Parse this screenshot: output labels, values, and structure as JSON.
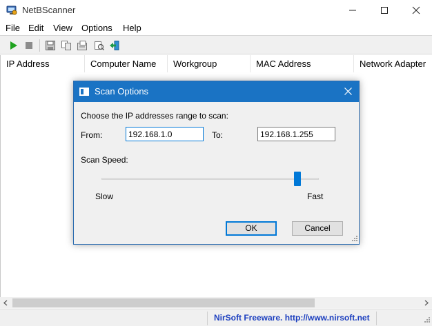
{
  "window": {
    "title": "NetBScanner",
    "controls": {
      "minimize": "minimize",
      "maximize": "maximize",
      "close": "close"
    }
  },
  "menu": [
    "File",
    "Edit",
    "View",
    "Options",
    "Help"
  ],
  "toolbar": {
    "icons": [
      "play-icon",
      "stop-icon",
      "save-icon",
      "copy-icon",
      "properties-icon",
      "refresh-icon",
      "exit-icon"
    ]
  },
  "table": {
    "columns": [
      "IP Address",
      "Computer Name",
      "Workgroup",
      "MAC Address",
      "Network Adapter"
    ],
    "rows": []
  },
  "status": {
    "link": "NirSoft Freeware.  http://www.nirsoft.net"
  },
  "dialog": {
    "title": "Scan Options",
    "range_prompt": "Choose the IP addresses range to scan:",
    "from_label": "From:",
    "from_value": "192.168.1.0",
    "to_label": "To:",
    "to_value": "192.168.1.255",
    "speed_label": "Scan Speed:",
    "speed_min_label": "Slow",
    "speed_max_label": "Fast",
    "speed_level": 0.9,
    "ok_label": "OK",
    "cancel_label": "Cancel"
  },
  "colors": {
    "dialog_title_bg": "#1a73c4",
    "accent": "#0078d7",
    "link": "#1c3fbf",
    "play_green": "#1fa31f"
  }
}
